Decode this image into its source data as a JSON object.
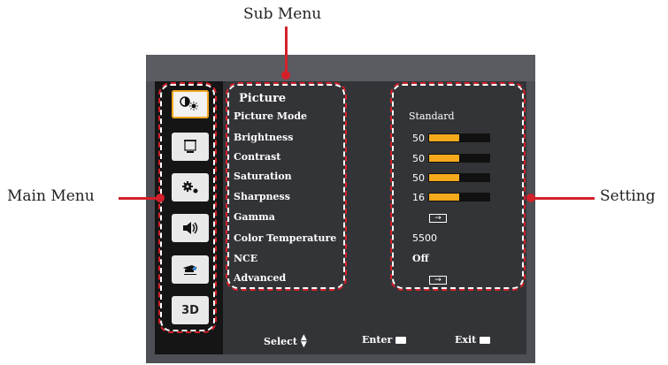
{
  "callouts": {
    "sub_menu": "Sub Menu",
    "main_menu": "Main Menu",
    "setting": "Setting"
  },
  "main_menu": {
    "items": [
      {
        "icon": "picture-icon",
        "label": "",
        "active": true
      },
      {
        "icon": "screen-icon",
        "label": ""
      },
      {
        "icon": "settings-icon",
        "label": ""
      },
      {
        "icon": "volume-icon",
        "label": ""
      },
      {
        "icon": "projector-icon",
        "label": ""
      },
      {
        "icon": "3d-icon",
        "label": "3D"
      }
    ]
  },
  "sub_menu": {
    "title": "Picture",
    "items": [
      {
        "label": "Picture Mode",
        "value": "Standard"
      },
      {
        "label": "Brightness",
        "value": "50",
        "level": 0.5
      },
      {
        "label": "Contrast",
        "value": "50",
        "level": 0.5
      },
      {
        "label": "Saturation",
        "value": "50",
        "level": 0.5
      },
      {
        "label": "Sharpness",
        "value": "16",
        "level": 0.5
      },
      {
        "label": "Gamma",
        "value": "",
        "arrow": true
      },
      {
        "label": "Color Temperature",
        "value": "5500"
      },
      {
        "label": "NCE",
        "value": "Off"
      },
      {
        "label": "Advanced",
        "value": "",
        "arrow": true
      }
    ]
  },
  "footer": {
    "select": "Select",
    "enter": "Enter",
    "exit": "Exit"
  },
  "colors": {
    "accent": "#f6a91b",
    "callout": "#d4202a"
  }
}
